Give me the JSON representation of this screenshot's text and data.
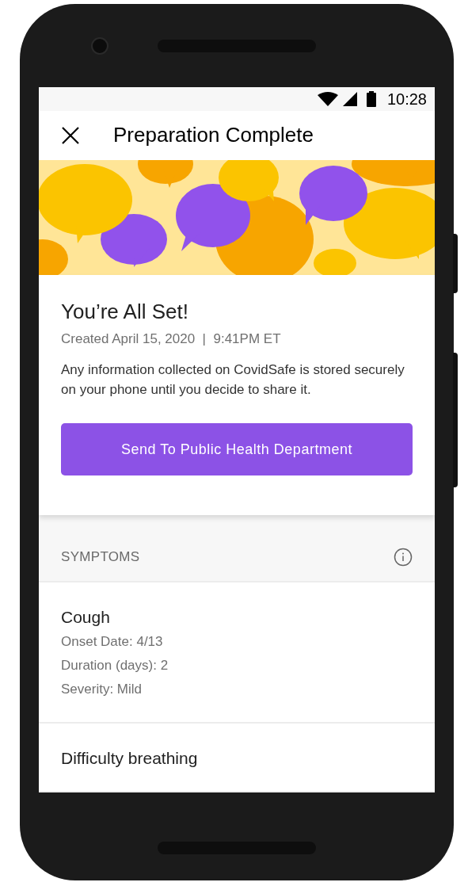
{
  "status_bar": {
    "time": "10:28"
  },
  "header": {
    "title": "Preparation Complete"
  },
  "card": {
    "title": "You’re All Set!",
    "created": "Created April 15, 2020  |  9:41PM ET",
    "body": "Any information collected on CovidSafe is stored securely on your phone until you decide to share it.",
    "button": "Send To Public Health Department"
  },
  "symptoms": {
    "heading": "SYMPTOMS",
    "items": [
      {
        "name": "Cough",
        "details": [
          "Onset Date: 4/13",
          "Duration (days): 2",
          "Severity: Mild"
        ]
      },
      {
        "name": "Difficulty breathing"
      }
    ]
  }
}
